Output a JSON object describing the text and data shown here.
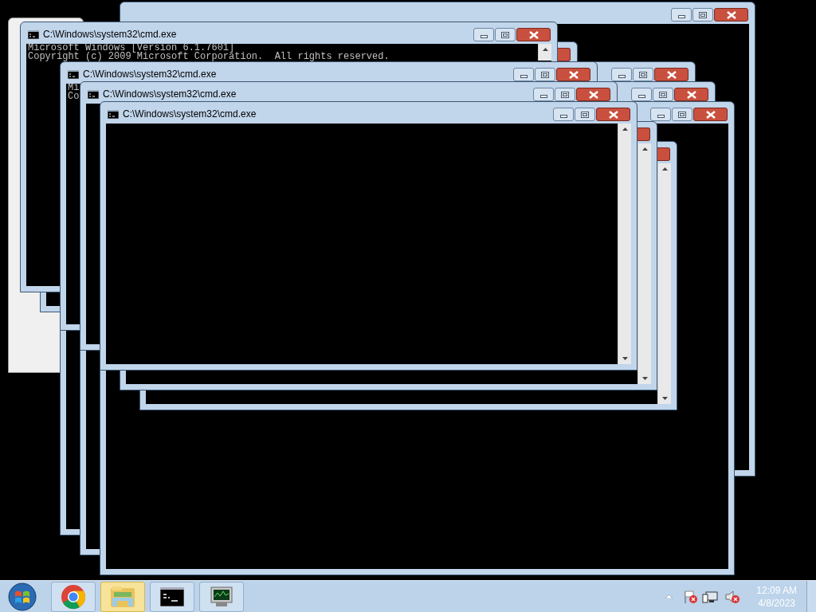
{
  "windows": [
    {
      "kind": "app"
    },
    {
      "kind": "frame"
    },
    {
      "kind": "frame"
    },
    {
      "kind": "frame"
    },
    {
      "kind": "frame"
    },
    {
      "kind": "console"
    },
    {
      "kind": "console"
    },
    {
      "kind": "frame"
    },
    {
      "kind": "console",
      "title": "C:\\Windows\\system32\\cmd.exe",
      "console_lines": [
        "Microsoft Windows [Version 6.1.7601]",
        "Copyright (c) 2009 Microsoft Corporation.  All rights reserved."
      ]
    },
    {
      "kind": "frame",
      "title": "C:\\Windows\\system32\\cmd.exe",
      "console_lines": [
        "Mi",
        "Co"
      ]
    },
    {
      "kind": "frame",
      "title": "C:\\Windows\\system32\\cmd.exe"
    },
    {
      "kind": "console",
      "title": "C:\\Windows\\system32\\cmd.exe"
    }
  ],
  "taskbar": {
    "items": [
      {
        "kind": "start"
      },
      {
        "kind": "browser",
        "flashing": false
      },
      {
        "kind": "folder",
        "flashing": true
      },
      {
        "kind": "console",
        "flashing": false
      },
      {
        "kind": "monitor",
        "flashing": false
      }
    ]
  },
  "clock": {
    "time": "12:09 AM",
    "date": "4/8/2023"
  }
}
